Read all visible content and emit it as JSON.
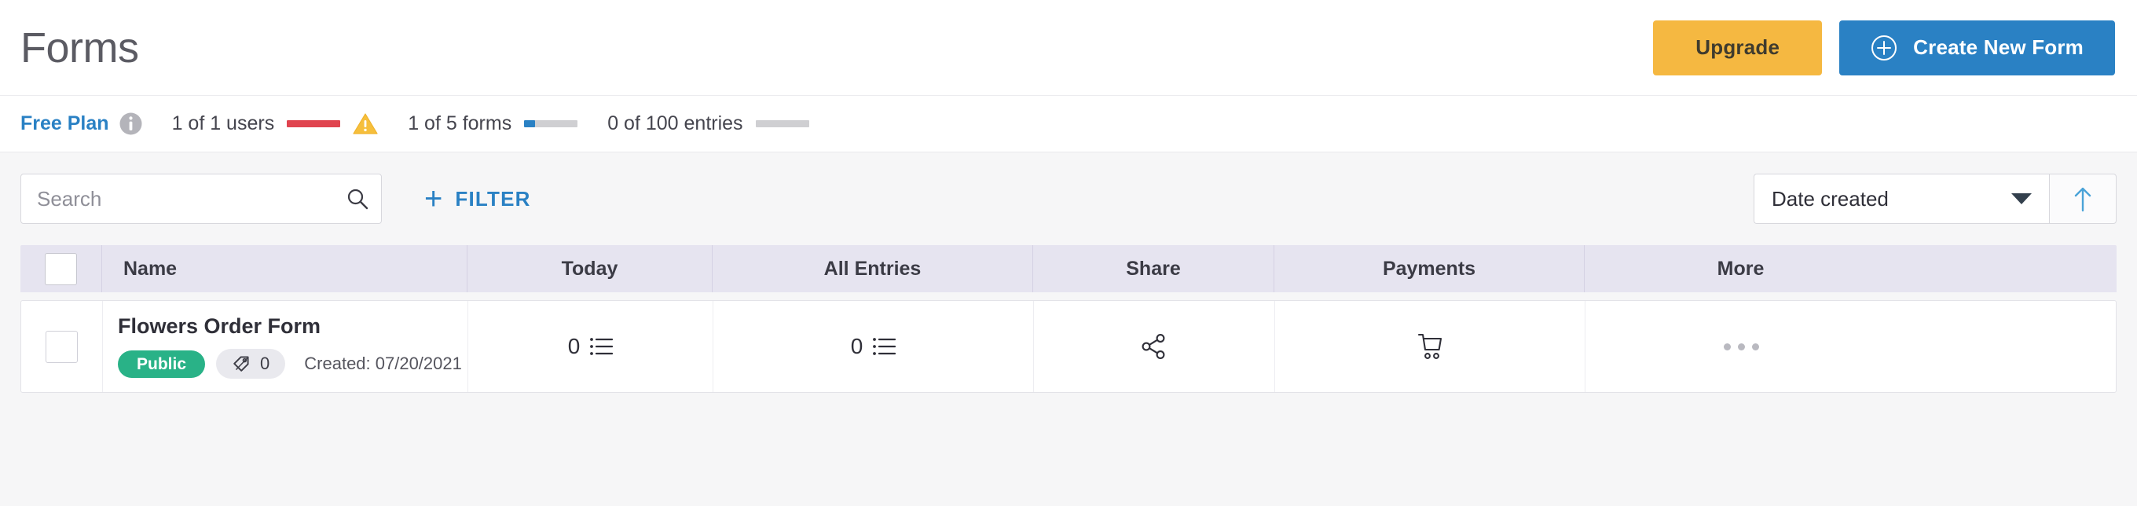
{
  "header": {
    "title": "Forms",
    "upgrade_label": "Upgrade",
    "create_label": "Create New Form",
    "create_icon": "plus-circle-icon",
    "upgrade_color": "#f5b841",
    "create_color": "#2a81c4"
  },
  "plan": {
    "name": "Free Plan",
    "info_icon": "info-circle-icon",
    "warning_icon": "warning-triangle-icon",
    "usage": [
      {
        "label": "1 of 1 users",
        "percent": 100,
        "color": "#e0444f"
      },
      {
        "label": "1 of 5 forms",
        "percent": 20,
        "color": "#2a81c4"
      },
      {
        "label": "0 of 100 entries",
        "percent": 0,
        "color": "#cfcfd2"
      }
    ]
  },
  "toolbar": {
    "search_placeholder": "Search",
    "search_value": "",
    "search_icon": "search-icon",
    "filter_label": "FILTER",
    "filter_icon": "plus-icon",
    "sort_value": "Date created",
    "sort_caret_icon": "chevron-down-icon",
    "sort_direction_icon": "arrow-up-icon",
    "accent_color": "#2a81c4"
  },
  "table": {
    "columns": [
      "",
      "Name",
      "Today",
      "All Entries",
      "Share",
      "Payments",
      "More"
    ],
    "header_bg": "#e6e4f0",
    "rows": [
      {
        "name": "Flowers Order Form",
        "status": "Public",
        "status_color": "#29b287",
        "tag_icon": "tag-icon",
        "tag_count": "0",
        "created": "Created: 07/20/2021",
        "today_count": "0",
        "today_icon": "list-icon",
        "all_entries_count": "0",
        "all_entries_icon": "list-icon",
        "share_icon": "share-nodes-icon",
        "payments_icon": "shopping-cart-icon",
        "more_icon": "ellipsis-icon"
      }
    ]
  }
}
